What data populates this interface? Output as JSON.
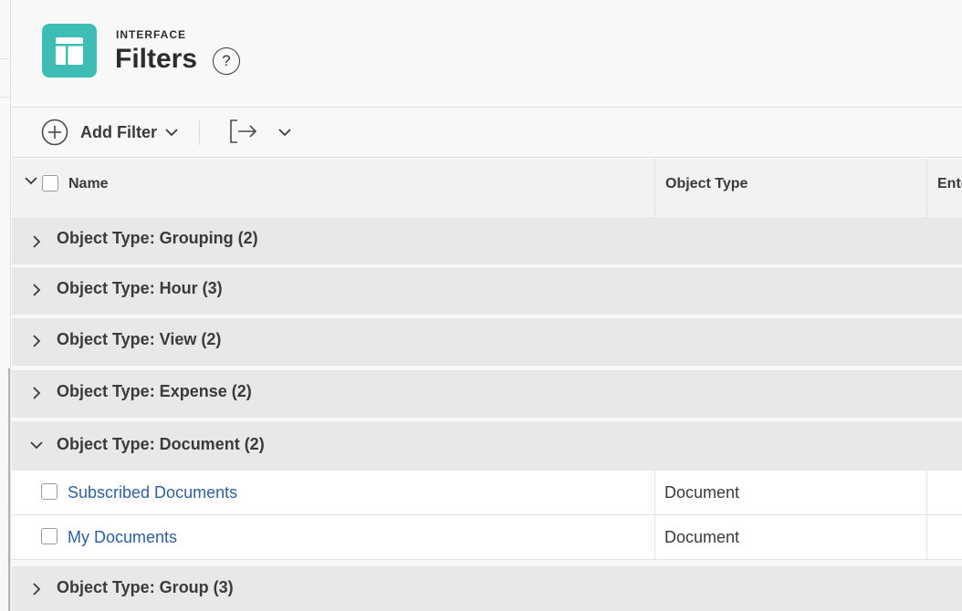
{
  "header": {
    "eyebrow": "INTERFACE",
    "title": "Filters",
    "help_label": "?",
    "app_icon": "layout-icon",
    "accent_color": "#3dbdb3"
  },
  "toolbar": {
    "add_filter_label": "Add Filter",
    "add_filter_icon": "plus-circle-icon",
    "export_icon": "export-icon"
  },
  "table": {
    "columns": [
      "Name",
      "Object Type",
      "Ente"
    ],
    "groups": [
      {
        "label": "Object Type: Grouping (2)",
        "expanded": false
      },
      {
        "label": "Object Type: Hour (3)",
        "expanded": false
      },
      {
        "label": "Object Type: View (2)",
        "expanded": false
      },
      {
        "label": "Object Type: Expense (2)",
        "expanded": false
      },
      {
        "label": "Object Type: Document (2)",
        "expanded": true
      },
      {
        "label": "Object Type: Group (3)",
        "expanded": false
      }
    ],
    "document_rows": [
      {
        "name": "Subscribed Documents",
        "type": "Document"
      },
      {
        "name": "My Documents",
        "type": "Document"
      }
    ]
  }
}
